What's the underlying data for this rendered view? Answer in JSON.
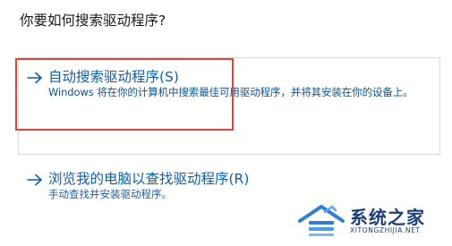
{
  "question": "你要如何搜索驱动程序?",
  "options": [
    {
      "title": "自动搜索驱动程序(S)",
      "description": "Windows 将在你的计算机中搜索最佳可用驱动程序，并将其安装在你的设备上。"
    },
    {
      "title": "浏览我的电脑以查找驱动程序(R)",
      "description": "手动查找并安装驱动程序。"
    }
  ],
  "watermark": {
    "name": "系统之家",
    "url": "XITONGZHIJIA.NET"
  },
  "colors": {
    "link": "#0f5fa8",
    "highlight": "#e0433e",
    "box_border": "#d9d9d9"
  },
  "icons": {
    "option_arrow": "arrow-right-icon",
    "watermark_logo": "house-logo-icon"
  }
}
